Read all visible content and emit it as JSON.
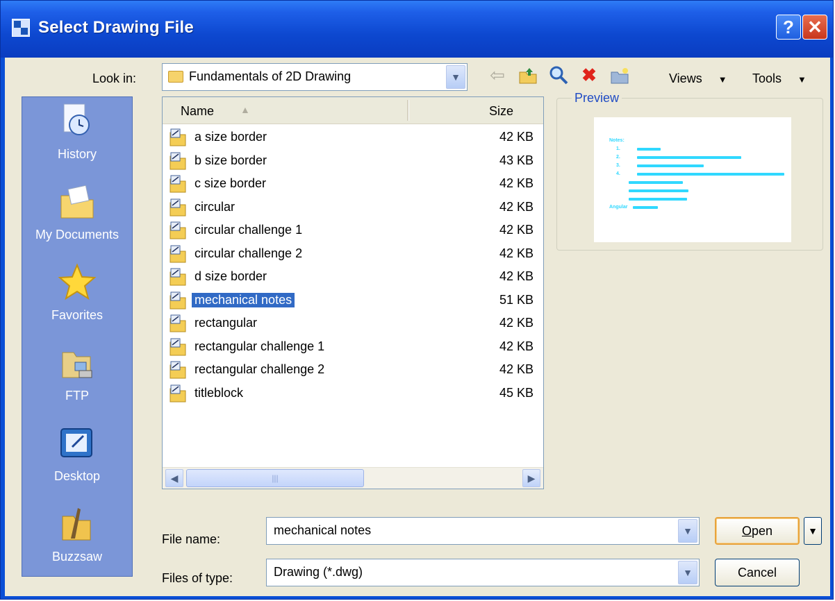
{
  "window": {
    "title": "Select Drawing File",
    "help_symbol": "?",
    "close_symbol": "✕"
  },
  "lookin": {
    "label": "Look in:",
    "value": "Fundamentals of 2D Drawing"
  },
  "toolbar": {
    "views_label": "Views",
    "tools_label": "Tools",
    "dropdown_arrow": "▼"
  },
  "places": [
    {
      "label": "History",
      "icon": "history-icon"
    },
    {
      "label": "My Documents",
      "icon": "my-documents-icon"
    },
    {
      "label": "Favorites",
      "icon": "favorites-icon"
    },
    {
      "label": "FTP",
      "icon": "ftp-icon"
    },
    {
      "label": "Desktop",
      "icon": "desktop-icon"
    },
    {
      "label": "Buzzsaw",
      "icon": "buzzsaw-icon"
    }
  ],
  "filelist": {
    "col_name": "Name",
    "col_size": "Size",
    "rows": [
      {
        "name": "a size border",
        "size": "42 KB"
      },
      {
        "name": "b size border",
        "size": "43 KB"
      },
      {
        "name": "c size border",
        "size": "42 KB"
      },
      {
        "name": "circular",
        "size": "42 KB"
      },
      {
        "name": "circular challenge 1",
        "size": "42 KB"
      },
      {
        "name": "circular challenge 2",
        "size": "42 KB"
      },
      {
        "name": "d size border",
        "size": "42 KB"
      },
      {
        "name": "mechanical notes",
        "size": "51 KB",
        "selected": true
      },
      {
        "name": "rectangular",
        "size": "42 KB"
      },
      {
        "name": "rectangular challenge 1",
        "size": "42 KB"
      },
      {
        "name": "rectangular challenge 2",
        "size": "42 KB"
      },
      {
        "name": "titleblock",
        "size": "45 KB"
      }
    ]
  },
  "preview": {
    "title": "Preview",
    "notes_heading": "Notes:",
    "item_numbers": [
      "1.",
      "2.",
      "3.",
      "4."
    ],
    "angular_label": "Angular"
  },
  "filename": {
    "label": "File name:",
    "value": "mechanical notes"
  },
  "filetype": {
    "label": "Files of type:",
    "value": "Drawing (*.dwg)"
  },
  "buttons": {
    "open": "Open",
    "cancel": "Cancel"
  },
  "colors": {
    "title_bar": "#0a4fd6",
    "places_bar": "#7b96d8",
    "selection": "#316ac5",
    "dialog_face": "#ece9d8",
    "preview_text": "#30d8ff"
  }
}
